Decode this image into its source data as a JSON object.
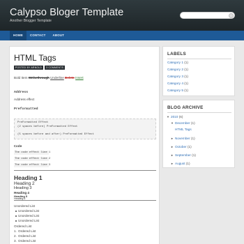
{
  "header": {
    "title": "Calypso Bloger Template",
    "description": "Another Blogger Template",
    "search_placeholder": ""
  },
  "nav": {
    "items": [
      {
        "label": "HOME",
        "active": true
      },
      {
        "label": "CONTACT",
        "active": false
      },
      {
        "label": "ABOUT",
        "active": false
      }
    ]
  },
  "post": {
    "title": "HTML Tags",
    "meta": [
      "POSTED BY ARNOLD",
      "3 COMMENTS"
    ],
    "inline": {
      "bold": "Bold Item",
      "strikethrough": "Strikethrough",
      "underline": "Underline",
      "delete": "Delete",
      "insert": "Insert"
    },
    "address_label": "Address",
    "address_text": "Address effect",
    "preformatted_label": "Preformatted",
    "pre_lines": [
      "PreFormatted Effect",
      "  (2 spaces before)   PreFormatted Effect",
      "",
      "  (5 spaces before and after)      PreFormatted Effect"
    ],
    "code_label": "Code",
    "code_lines": [
      "The code effect line 1",
      "The code effect line 2",
      "The code effect line 3"
    ],
    "headings": [
      "Heading 1",
      "Heading 2",
      "Heading 3",
      "Heading 4",
      "Heading 5",
      "Heading 6"
    ],
    "unordered_label": "Unordered List",
    "unordered_items": [
      "Unordered List",
      "Unordered List",
      "Unordered List"
    ],
    "ordered_label": "Ordered List",
    "ordered_items": [
      "Ordered List",
      "Ordered List",
      "Ordered List"
    ]
  },
  "labels_widget": {
    "title": "LABELS",
    "items": [
      {
        "name": "Category 1",
        "count": "(1)"
      },
      {
        "name": "Category 2",
        "count": "(1)"
      },
      {
        "name": "Category 3",
        "count": "(1)"
      },
      {
        "name": "Category 4",
        "count": "(1)"
      },
      {
        "name": "Category 5",
        "count": "(1)"
      }
    ]
  },
  "archive_widget": {
    "title": "BLOG ARCHIVE",
    "year": {
      "label": "2010",
      "count": "(6)",
      "arrow": "▼"
    },
    "december": {
      "label": "December",
      "count": "(1)",
      "arrow": "▼"
    },
    "december_post": "HTML Tags",
    "months": [
      {
        "label": "November",
        "count": "(1)",
        "arrow": "►"
      },
      {
        "label": "October",
        "count": "(1)",
        "arrow": "►"
      },
      {
        "label": "September",
        "count": "(1)",
        "arrow": "►"
      },
      {
        "label": "August",
        "count": "(1)",
        "arrow": "►"
      }
    ]
  }
}
